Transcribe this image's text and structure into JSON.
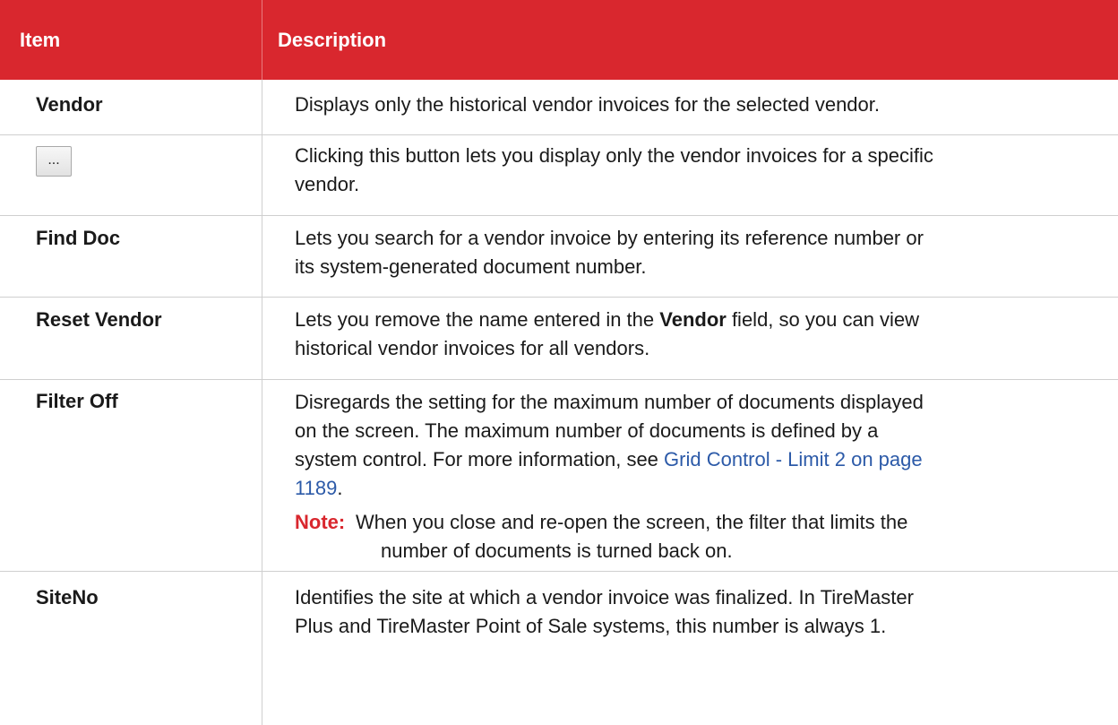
{
  "header": {
    "item_label": "Item",
    "description_label": "Description"
  },
  "rows": [
    {
      "item": "Vendor",
      "description": "Displays only the historical vendor invoices for the selected vendor."
    },
    {
      "item_button_label": "...",
      "item_icon": "ellipsis-button-icon",
      "description_line1": "Clicking this button lets you display only the vendor invoices for a specific",
      "description_line2": "vendor."
    },
    {
      "item": "Find Doc",
      "description_line1": "Lets you search for a vendor invoice by entering its reference number or",
      "description_line2": "its system-generated document number."
    },
    {
      "item": "Reset Vendor",
      "description_part1": "Lets you remove the name entered in the ",
      "description_bold": "Vendor",
      "description_part2": " field, so you can view",
      "description_line2": "historical vendor invoices for all vendors."
    },
    {
      "item": "Filter Off",
      "description_line1": "Disregards the setting for the maximum number of documents displayed",
      "description_line2": "on the screen. The maximum number of documents is defined by a",
      "description_line3_part1": "system control. For more information, see ",
      "description_link": "Grid Control - Limit 2 on page",
      "description_link_cont": "1189",
      "description_line4_tail": ".",
      "note_label": "Note:",
      "note_line1": "When you close and re-open the screen, the filter that limits the",
      "note_line2": "number of documents is turned back on."
    },
    {
      "item": "SiteNo",
      "description_line1": "Identifies the site at which a vendor invoice was finalized. In TireMaster",
      "description_line2": "Plus and TireMaster Point of Sale systems, this number is always 1."
    }
  ],
  "colors": {
    "header_bg": "#d9272e",
    "header_text": "#ffffff",
    "link": "#2c5aa8",
    "note": "#d9272e",
    "row_border": "#cfcfcf"
  }
}
